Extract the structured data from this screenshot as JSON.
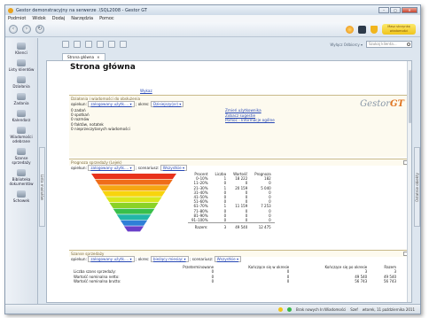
{
  "window": {
    "title": "Gestor demonstracyjny na serwerze .\\SQL2008 - Gestor GT"
  },
  "window_buttons": {
    "minimize": "–",
    "maximize": "▢",
    "close": "✕"
  },
  "menu": [
    "Podmiot",
    "Widok",
    "Dodaj",
    "Narzędzia",
    "Pomoc"
  ],
  "header": {
    "message_badge": "Masz skrzynkę wiadomości"
  },
  "sidebar": {
    "items": [
      {
        "label": "Klienci",
        "icon": "clients-icon"
      },
      {
        "label": "Listy klientów",
        "icon": "client-lists-icon"
      },
      {
        "label": "Działania",
        "icon": "actions-icon"
      },
      {
        "label": "Zadania",
        "icon": "tasks-icon"
      },
      {
        "label": "Kalendarz",
        "icon": "calendar-icon"
      },
      {
        "label": "Wiadomości odebrane",
        "icon": "inbox-icon"
      },
      {
        "label": "Szanse sprzedaży",
        "icon": "opportunities-icon"
      },
      {
        "label": "Biblioteka dokumentów",
        "icon": "library-icon"
      },
      {
        "label": "Schowek",
        "icon": "clipboard-icon"
      }
    ],
    "left_tab": "Lista modułów",
    "right_tab": "Ostatnie obiekty"
  },
  "toolbar": {
    "filter_label": "Wyłącz Odbiorcy ▾",
    "search_placeholder": "Szukaj klienta..."
  },
  "tab": {
    "label": "Strona główna",
    "close": "×"
  },
  "page": {
    "title": "Strona główna",
    "wykaz_link": "Wykaz"
  },
  "logo": {
    "text": "Gestor",
    "accent": "GT"
  },
  "actions_panel": {
    "title": "Działania i wiadomości do obsłużenia",
    "opiekun_label": "opiekun:",
    "opiekun_value": "zalogowany użytk.... ▾",
    "okres_label": "; okres:",
    "okres_value": "Dzisiejszy(ar) ▾",
    "items": [
      "0 zadań",
      "0 spotkań",
      "0 rozmów",
      "0 faktów, notatek",
      "0 nieprzeczytanych wiadomości"
    ],
    "links": [
      "Zmień użytkownika",
      "Zobacz sugestie",
      "Pomoc - Informacje ogólne"
    ]
  },
  "forecast_panel": {
    "title": "Prognoza sprzedaży (Lejek)",
    "opiekun_label": "opiekun:",
    "opiekun_value": "zalogowany użytk.... ▾",
    "scenariusz_label": "; scenariusz:",
    "scenariusz_value": "Wszystkie ▾",
    "headers": [
      "Procent",
      "Liczba",
      "Wartość",
      "Prognoza"
    ],
    "rows": [
      [
        "0–10%",
        "1",
        "18 222",
        "182"
      ],
      [
        "11–20%",
        "0",
        "0",
        "0"
      ],
      [
        "21–30%",
        "1",
        "20 159",
        "5 040"
      ],
      [
        "31–40%",
        "0",
        "0",
        "0"
      ],
      [
        "41–50%",
        "0",
        "0",
        "0"
      ],
      [
        "51–60%",
        "0",
        "0",
        "0"
      ],
      [
        "61–70%",
        "1",
        "11 159",
        "7 253"
      ],
      [
        "71–80%",
        "0",
        "0",
        "0"
      ],
      [
        "81–90%",
        "0",
        "0",
        "0"
      ],
      [
        "91–100%",
        "0",
        "0",
        "0"
      ]
    ],
    "total": [
      "Razem:",
      "3",
      "49 540",
      "12 475"
    ],
    "funnel_colors": [
      "#e8321c",
      "#ef6d1a",
      "#f5a512",
      "#f8d40d",
      "#d7e81c",
      "#8bd226",
      "#39bf4a",
      "#22b6a8",
      "#2f7fd7",
      "#6a3fc9"
    ]
  },
  "opportunities_panel": {
    "title": "Szanse sprzedaży",
    "opiekun_label": "opiekun:",
    "opiekun_value": "zalogowany użytk.... ▾",
    "okres_label": "; okres:",
    "okres_value": "bieżący miesiąc ▾",
    "scenariusz_label": "; scenariusz:",
    "scenariusz_value": "Wszystkie ▾",
    "headers": [
      "",
      "Przeterminowane",
      "Kończące się w okresie",
      "Kończące się po okresie",
      "Razem"
    ],
    "rows": [
      [
        "Liczba szans sprzedaży:",
        "0",
        "0",
        "3",
        "3"
      ],
      [
        "Wartość nominalna netto:",
        "0",
        "0",
        "49 540",
        "49 540"
      ],
      [
        "Wartość nominalna brutto:",
        "0",
        "0",
        "56 743",
        "56 743"
      ]
    ]
  },
  "status": {
    "text": "Brak nowych In:Wiadomości",
    "user": "Szef",
    "date": "wtorek, 11 października 2011"
  }
}
